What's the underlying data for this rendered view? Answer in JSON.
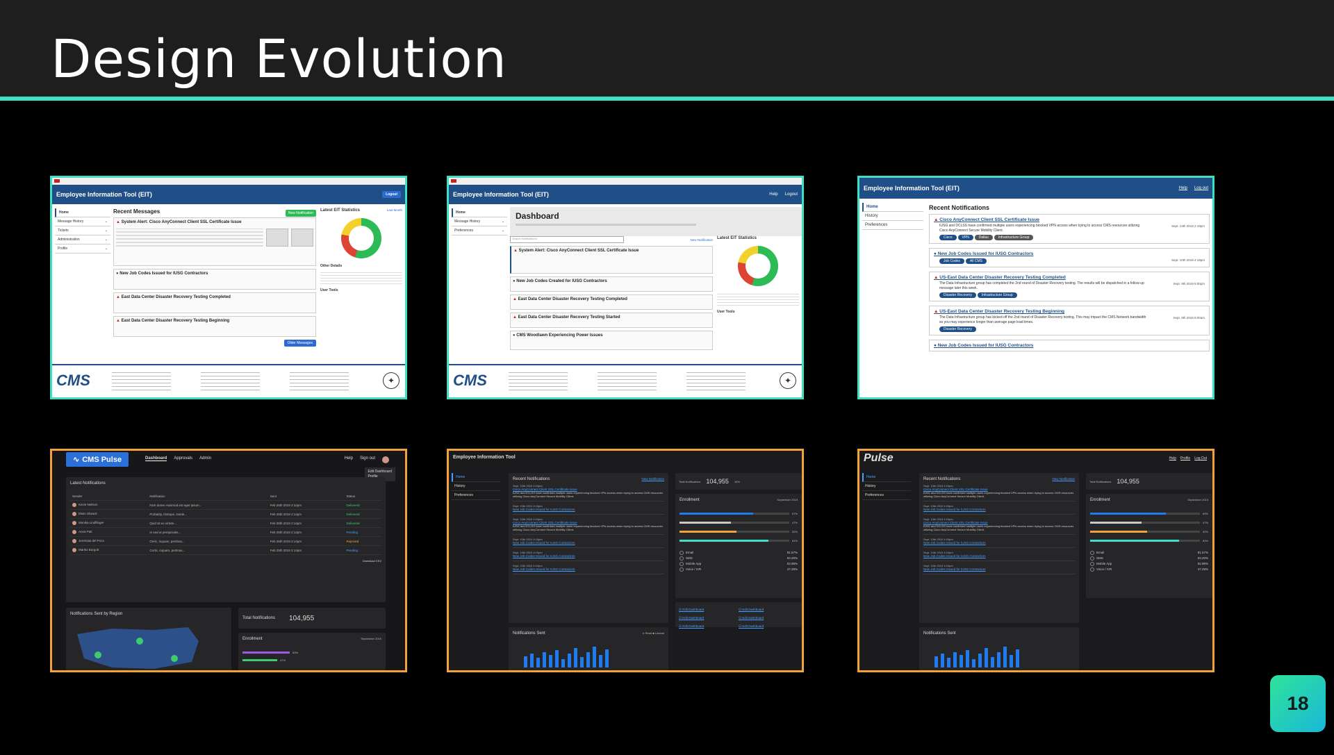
{
  "slide": {
    "title": "Design Evolution",
    "page_number": "18"
  },
  "colors": {
    "accent_teal": "#3ee0c4",
    "accent_orange": "#f2a23a",
    "brand_blue": "#1f4f86",
    "link_blue": "#4aa0ff"
  },
  "v1": {
    "app_title": "Employee Information Tool (EIT)",
    "logout": "Logout",
    "nav": [
      "Home",
      "Message History",
      "Tickets",
      "Administration",
      "Profile"
    ],
    "recent_messages": "Recent Messages",
    "new_notification": "New Notification",
    "messages": [
      {
        "title": "System Alert: Cisco AnyConnect Client SSL Certificate Issue",
        "type": "alert"
      },
      {
        "title": "New Job Codes Issued for IUSG Contractors",
        "type": "info"
      },
      {
        "title": "East Data Center Disaster Recovery Testing Completed",
        "type": "alert"
      },
      {
        "title": "East Data Center Disaster Recovery Testing Beginning",
        "type": "alert"
      }
    ],
    "stats_title": "Latest EIT Statistics",
    "last_month": "Last Month",
    "other_details": "Other Details",
    "user_tools": "User Tools",
    "older_messages": "Older Messages",
    "footer_logo": "CMS"
  },
  "v2": {
    "app_title": "Employee Information Tool (EIT)",
    "header_links": [
      "Help",
      "Logout"
    ],
    "nav": [
      "Home",
      "Message History",
      "Preferences"
    ],
    "dashboard": "Dashboard",
    "search_placeholder": "Search Notifications",
    "new_notification": "New Notification",
    "messages": [
      {
        "title": "System Alert: Cisco AnyConnect Client SSL Certificate Issue",
        "type": "alert"
      },
      {
        "title": "New Job Codes Created for IUSG Contractors",
        "type": "info"
      },
      {
        "title": "East Data Center Disaster Recovery Testing Completed",
        "type": "alert"
      },
      {
        "title": "East Data Center Disaster Recovery Testing Started",
        "type": "alert"
      },
      {
        "title": "CMS Woodlawn Experiencing Power Issues",
        "type": "info"
      }
    ],
    "stats_title": "Latest EIT Statistics",
    "user_tools": "User Tools",
    "footer_logo": "CMS"
  },
  "v3": {
    "app_title": "Employee Information Tool (EIT)",
    "header_links": [
      "Help",
      "Log out"
    ],
    "nav": [
      "Home",
      "History",
      "Preferences"
    ],
    "section_title": "Recent Notifications",
    "notifications": [
      {
        "title": "Cisco AnyConnect Client SSL Certificate Issue",
        "type": "alert",
        "body": "IUSG and DCLSS have confirmed multiple users experiencing blocked VPN access when trying to access CMS resources utilizing Cisco AnyConnect Secure Mobility Client.",
        "date": "Sept. 13th 2019 2:18pm",
        "tags": [
          "Cisco",
          "VPN",
          "Dallas",
          "Infrastructure Group"
        ]
      },
      {
        "title": "New Job Codes Issued for IUSG Contractors",
        "type": "info",
        "body": "",
        "date": "Sept. 10th 2019 4:18pm",
        "tags": [
          "Job Codes",
          "All CMS"
        ]
      },
      {
        "title": "US-East Data Center Disaster Recovery Testing Completed",
        "type": "alert",
        "body": "The Data Infrastructure group has completed the 2nd round of Disaster Recovery testing. The results will be dispatched in a follow-up message later this week.",
        "date": "Sept. 9th 2019 5:00pm",
        "tags": [
          "Disaster Recovery",
          "Infrastructure Group"
        ]
      },
      {
        "title": "US-East Data Center Disaster Recovery Testing Beginning",
        "type": "alert",
        "body": "The Data Infrastructure group has kicked off the 2nd round of Disaster Recovery testing. This may impact the CMS Network bandwidth so you may experience longer than average page load times.",
        "date": "Sept. 9th 2019 8:00am",
        "tags": [
          "Disaster Recovery"
        ]
      },
      {
        "title": "New Job Codes Issued for IUSG Contractors",
        "type": "info",
        "body": "",
        "date": "",
        "tags": []
      }
    ]
  },
  "v4": {
    "logo": "CMS Pulse",
    "tabs": [
      "Dashboard",
      "Approvals",
      "Admin"
    ],
    "header_links": [
      "Help",
      "Sign out"
    ],
    "dropdown": [
      "Edit Dashboard",
      "Profile"
    ],
    "latest_title": "Latest Notifications",
    "columns": [
      "Sender",
      "Notification",
      "Sent",
      "Status"
    ],
    "rows": [
      {
        "sender": "Kevin Neilson",
        "text": "Fam donec euismod est eget ipsum...",
        "sent": "Feb 25th 2019 2:14pm",
        "status": "Delivered"
      },
      {
        "sender": "Elwin Sheard",
        "text": "Probably, tristique, inside...",
        "sent": "Feb 25th 2019 2:14pm",
        "status": "Delivered"
      },
      {
        "sender": "Monika Lindflinger",
        "text": "Quid sit ex virtute...",
        "sent": "Feb 25th 2019 2:14pm",
        "status": "Delivered"
      },
      {
        "sender": "Anna Pati",
        "text": "In sed ut perspiciatis...",
        "sent": "Feb 25th 2019 2:14pm",
        "status": "Pending"
      },
      {
        "sender": "Jeremias del Pozo",
        "text": "Oreic, inquam, pertinax...",
        "sent": "Feb 25th 2019 2:14pm",
        "status": "Rejected"
      },
      {
        "sender": "Mariko Burgott",
        "text": "Corlic, inquam, pertinax...",
        "sent": "Feb 25th 2019 2:14pm",
        "status": "Pending"
      }
    ],
    "download": "Download CSV",
    "region_title": "Notifications Sent by Region",
    "total_label": "Total Notifications",
    "total_value": "104,955",
    "enrollment": "Enrollment",
    "month": "September 2019",
    "enroll_pct": [
      "63%",
      "47%"
    ]
  },
  "v5": {
    "app_title": "Employee Information Tool",
    "nav": [
      "Home",
      "History",
      "Preferences"
    ],
    "recent": "Recent Notifications",
    "new_notification": "New Notification",
    "items": [
      {
        "date": "Sept. 13th 2019 4:19pm",
        "link": "Cisco AnyConnect Client SSL Certificate Issue",
        "body": "IUSG and DCLSS have confirmed multiple users experiencing blocked VPN access when trying to access CMS resources utilizing Cisco AnyConnect Secure Mobility Client."
      },
      {
        "date": "Sept. 10th 2019 4:19pm",
        "link": "New Job Codes Issued for IUSG Contractors",
        "body": ""
      },
      {
        "date": "Sept. 13th 2019 4:19pm",
        "link": "Cisco AnyConnect Client SSL Certificate Issue",
        "body": "IUSG and DCLSS have confirmed multiple users experiencing blocked VPN access when trying to access CMS resources utilizing Cisco AnyConnect Secure Mobility Client."
      },
      {
        "date": "Sept. 10th 2019 4:19pm",
        "link": "New Job Codes Issued for IUSG Contractors",
        "body": ""
      },
      {
        "date": "Sept. 10th 2019 4:19pm",
        "link": "New Job Codes Issued for IUSG Contractors",
        "body": ""
      },
      {
        "date": "Sept. 10th 2019 4:19pm",
        "link": "New Job Codes Issued for IUSG Contractors",
        "body": ""
      }
    ],
    "total_label": "Total Notifications",
    "total_value": "104,955",
    "change": "16%",
    "change_note": "Since last month",
    "enrollment": "Enrollment",
    "month": "September 2019",
    "bars": [
      {
        "label": "67%",
        "value": 0.67
      },
      {
        "label": "47%",
        "value": 0.47
      },
      {
        "label": "52%",
        "value": 0.52
      },
      {
        "label": "81%",
        "value": 0.81
      }
    ],
    "legend": [
      {
        "name": "Email",
        "pct": "81.57%"
      },
      {
        "name": "SMS",
        "pct": "63.20%"
      },
      {
        "name": "Mobile App",
        "pct": "52.95%"
      },
      {
        "name": "Voice / IVR",
        "pct": "47.29%"
      }
    ],
    "edit_links": [
      "Edit Dashboard",
      "Edit Dashboard",
      "Edit Dashboard",
      "Edit Dashboard",
      "Edit Dashboard",
      "Edit Dashboard"
    ],
    "sent_title": "Notifications Sent",
    "sent_legend": [
      "Read",
      "Unread"
    ]
  },
  "v6": {
    "logo": "Pulse",
    "header_links": [
      "Help",
      "Profile",
      "Log Out"
    ],
    "nav": [
      "Home",
      "History",
      "Preferences"
    ],
    "recent": "Recent Notifications",
    "new_notification": "New Notification",
    "total_label": "Total Notifications",
    "total_value": "104,955",
    "enrollment": "Enrollment",
    "month": "September 2019",
    "bars": [
      {
        "label": "69%",
        "value": 0.69
      },
      {
        "label": "47%",
        "value": 0.47
      },
      {
        "label": "52%",
        "value": 0.52
      },
      {
        "label": "81%",
        "value": 0.81
      }
    ],
    "legend": [
      {
        "name": "Email",
        "pct": "81.57%"
      },
      {
        "name": "SMS",
        "pct": "63.20%"
      },
      {
        "name": "Mobile App",
        "pct": "52.95%"
      },
      {
        "name": "Voice / IVR",
        "pct": "47.29%"
      }
    ],
    "sent_title": "Notifications Sent"
  }
}
